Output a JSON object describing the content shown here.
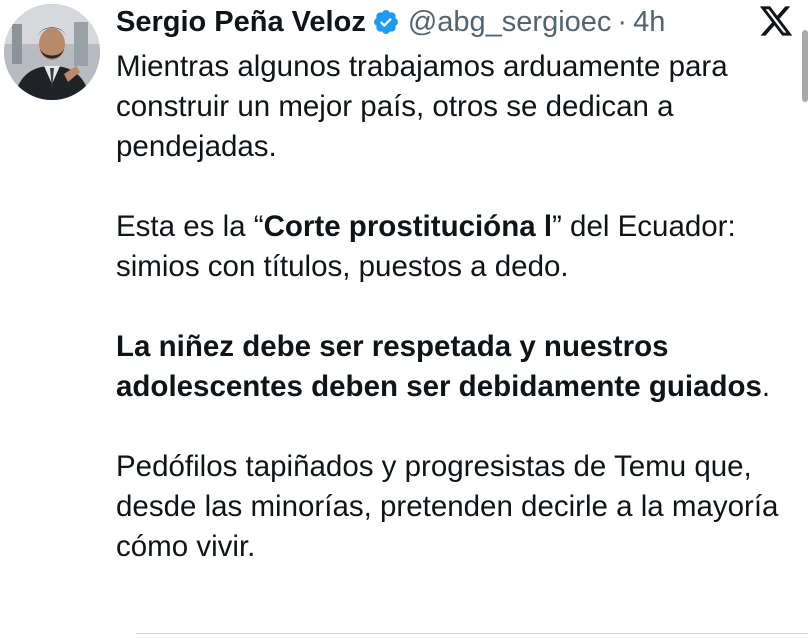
{
  "author": {
    "name": "Sergio Peña Veloz",
    "handle": "@abg_sergioec",
    "separator": "·",
    "time": "4h",
    "verified": true,
    "verified_color": "#1d9bf0"
  },
  "platform": {
    "logo_icon": "x-logo-icon"
  },
  "tweet": {
    "p1": "Mientras algunos trabajamos arduamente para construir un mejor país, otros se dedican a pendejadas.",
    "p2_before": "Esta es la “",
    "p2_bold": "Corte prostitucióna l",
    "p2_after": "” del Ecuador: simios con títulos, puestos a dedo.",
    "p3_bold": "La niñez debe ser respetada y nuestros adolescentes deben ser debidamente guiados",
    "p3_after": ".",
    "p4": "Pedófilos tapiñados y progresistas de Temu que, desde las minorías, pretenden decirle a la mayoría cómo vivir."
  }
}
